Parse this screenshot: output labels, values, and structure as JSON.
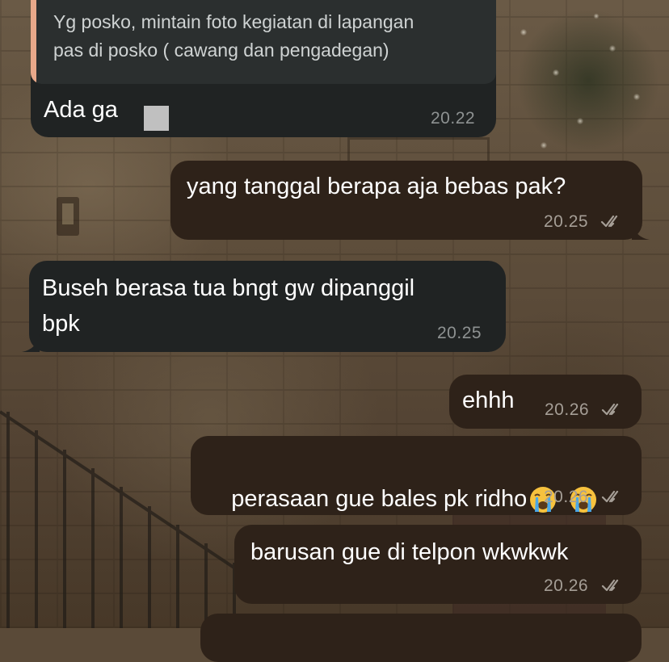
{
  "chat": {
    "quoted_message": {
      "text_line1": "Yg posko, mintain foto kegiatan di lapangan",
      "text_line2": "pas di posko ( cawang dan pengadegan)",
      "accent_color": "#e8a88a"
    },
    "messages": [
      {
        "direction": "incoming",
        "text": "Ada ga",
        "time": "20.22"
      },
      {
        "direction": "outgoing",
        "text": "yang tanggal berapa aja bebas pak?",
        "time": "20.25",
        "status": "read"
      },
      {
        "direction": "incoming",
        "text_line1": "Buseh berasa tua bngt gw dipanggil",
        "text_line2": "bpk",
        "time": "20.25"
      },
      {
        "direction": "outgoing",
        "text": "ehhh",
        "time": "20.26",
        "status": "read"
      },
      {
        "direction": "outgoing",
        "text": "perasaan gue bales pk ridho",
        "emoji": [
          "loudly-crying-face",
          "loudly-crying-face"
        ],
        "time": "20.26",
        "status": "read"
      },
      {
        "direction": "outgoing",
        "text": "barusan gue di telpon wkwkwk",
        "time": "20.26",
        "status": "read"
      }
    ]
  },
  "colors": {
    "incoming_bubble": "#202323",
    "outgoing_bubble": "#2e2219",
    "timestamp": "#a59e96"
  }
}
